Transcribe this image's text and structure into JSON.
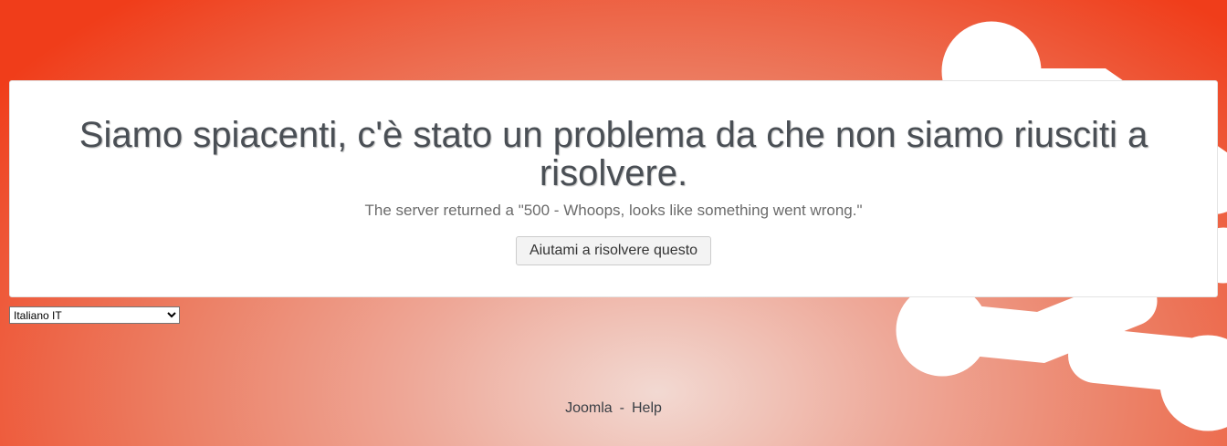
{
  "error": {
    "title": "Siamo spiacenti, c'è stato un problema da che non siamo riusciti a risolvere.",
    "message": "The server returned a \"500 - Whoops, looks like something went wrong.\"",
    "help_button": "Aiutami a risolvere questo"
  },
  "language_select": {
    "selected": "Italiano IT"
  },
  "footer": {
    "links": [
      "Joomla",
      "Help"
    ],
    "separator": "-"
  },
  "colors": {
    "background_accent": "#f03d1a",
    "card": "#ffffff"
  }
}
